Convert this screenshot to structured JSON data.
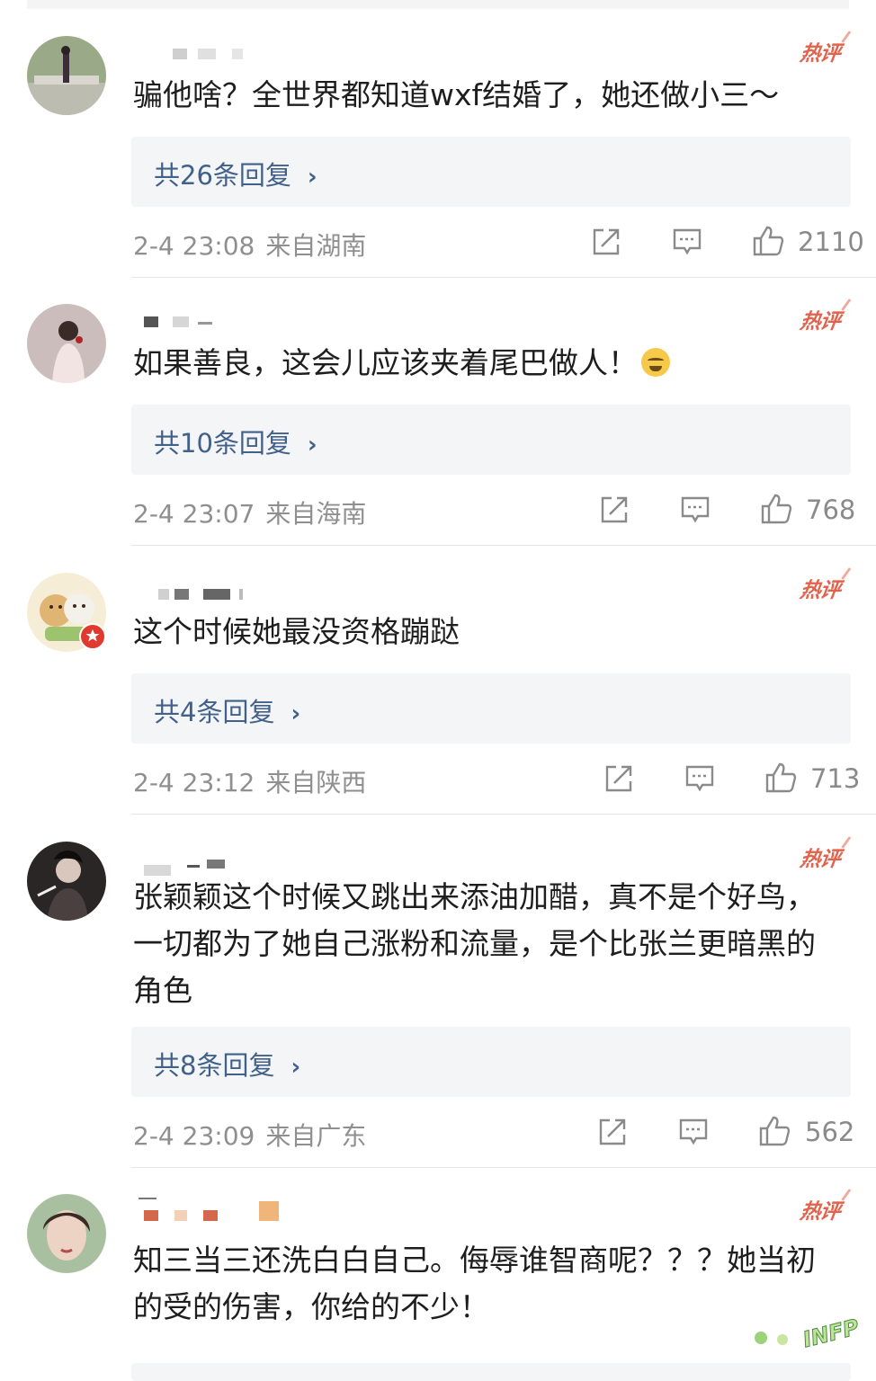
{
  "comments": [
    {
      "hot_badge": "热评",
      "text": "骗他啥？全世界都知道wxf结婚了，她还做小三～",
      "reply_label": "共26条回复",
      "time": "2-4 23:08",
      "location": "来自湖南",
      "likes": "2110",
      "avatar_color": "#7d8a6a"
    },
    {
      "hot_badge": "热评",
      "text": "如果善良，这会儿应该夹着尾巴做人！",
      "emoji": "crying-face-emoji",
      "reply_label": "共10条回复",
      "time": "2-4 23:07",
      "location": "来自海南",
      "likes": "768",
      "avatar_color": "#b9a9a6"
    },
    {
      "hot_badge": "热评",
      "text": "这个时候她最没资格蹦跶",
      "reply_label": "共4条回复",
      "time": "2-4 23:12",
      "location": "来自陕西",
      "likes": "713",
      "avatar_color": "#f0dcae"
    },
    {
      "hot_badge": "热评",
      "text": "张颖颖这个时候又跳出来添油加醋，真不是个好鸟，一切都为了她自己涨粉和流量，是个比张兰更暗黑的角色",
      "reply_label": "共8条回复",
      "time": "2-4 23:09",
      "location": "来自广东",
      "likes": "562",
      "avatar_color": "#3a3434"
    },
    {
      "hot_badge": "热评",
      "text": "知三当三还洗白白自己。侮辱谁智商呢？？？她当初的受的伤害，你给的不少！",
      "avatar_color": "#c9b7a6"
    }
  ],
  "icons": {
    "share": "share-icon",
    "comment": "comment-icon",
    "like": "thumbs-up-icon",
    "chevron": "chevron-right-icon"
  },
  "watermark": "INFP",
  "colors": {
    "hot_badge": "#e2634d",
    "reply_link": "#41608a",
    "meta_text": "#8f8f8f",
    "reply_bg": "#f4f5f6"
  }
}
